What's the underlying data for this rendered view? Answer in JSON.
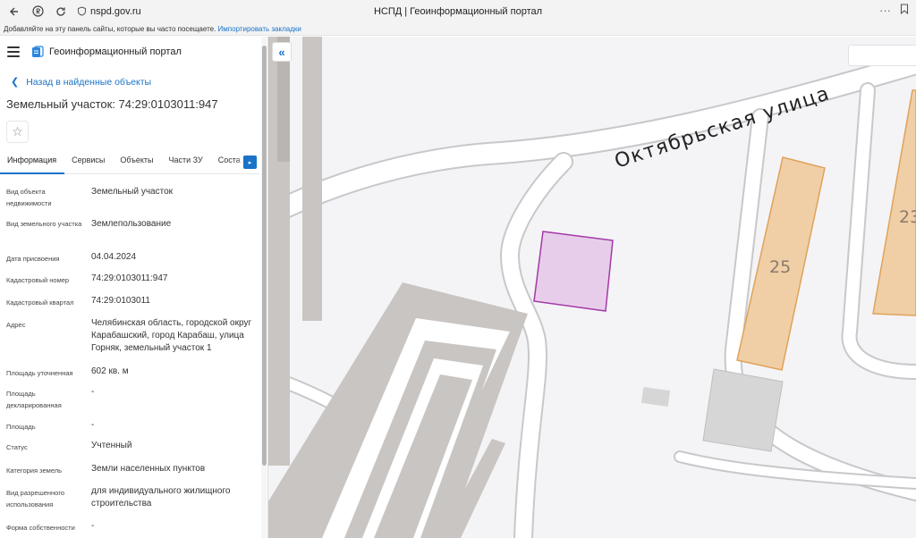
{
  "browser": {
    "url": "nspd.gov.ru",
    "tab_title": "НСПД | Геоинформационный портал",
    "bookmarks_text": "Добавляйте на эту панель сайты, которые вы часто посещаете.",
    "bookmarks_link": "Импортировать закладки"
  },
  "app": {
    "title": "Геоинформационный портал",
    "back_label": "Назад в найденные объекты",
    "object_title": "Земельный участок: 74:29:0103011:947"
  },
  "tabs": [
    "Информация",
    "Сервисы",
    "Объекты",
    "Части ЗУ",
    "Соста"
  ],
  "properties": [
    {
      "label": "Вид объекта недвижимости",
      "value": "Земельный участок"
    },
    {
      "label": "Вид земельного участка",
      "value": "Землепользование"
    },
    {
      "label": "Дата присвоения",
      "value": "04.04.2024"
    },
    {
      "label": "Кадастровый номер",
      "value": "74:29:0103011:947"
    },
    {
      "label": "Кадастровый квартал",
      "value": "74:29:0103011"
    },
    {
      "label": "Адрес",
      "value": "Челябинская область, городской округ Карабашский, город Карабаш, улица Горняк, земельный участок 1"
    },
    {
      "label": "Площадь уточненная",
      "value": "602 кв. м"
    },
    {
      "label": "Площадь декларированная",
      "value": "-"
    },
    {
      "label": "Площадь",
      "value": "-"
    },
    {
      "label": "Статус",
      "value": "Учтенный"
    },
    {
      "label": "Категория земель",
      "value": "Земли населенных пунктов"
    },
    {
      "label": "Вид разрешенного использования",
      "value": "для индивидуального жилищного строительства"
    },
    {
      "label": "Форма собственности",
      "value": "-"
    }
  ],
  "map": {
    "street_label": "Октябрьская улица",
    "building_25": "25",
    "building_23": "23",
    "parcel_fill": "#e8cdea",
    "parcel_stroke": "#a33aa8",
    "building_fill": "#f0cfa6",
    "building_stroke": "#e0a25a"
  }
}
